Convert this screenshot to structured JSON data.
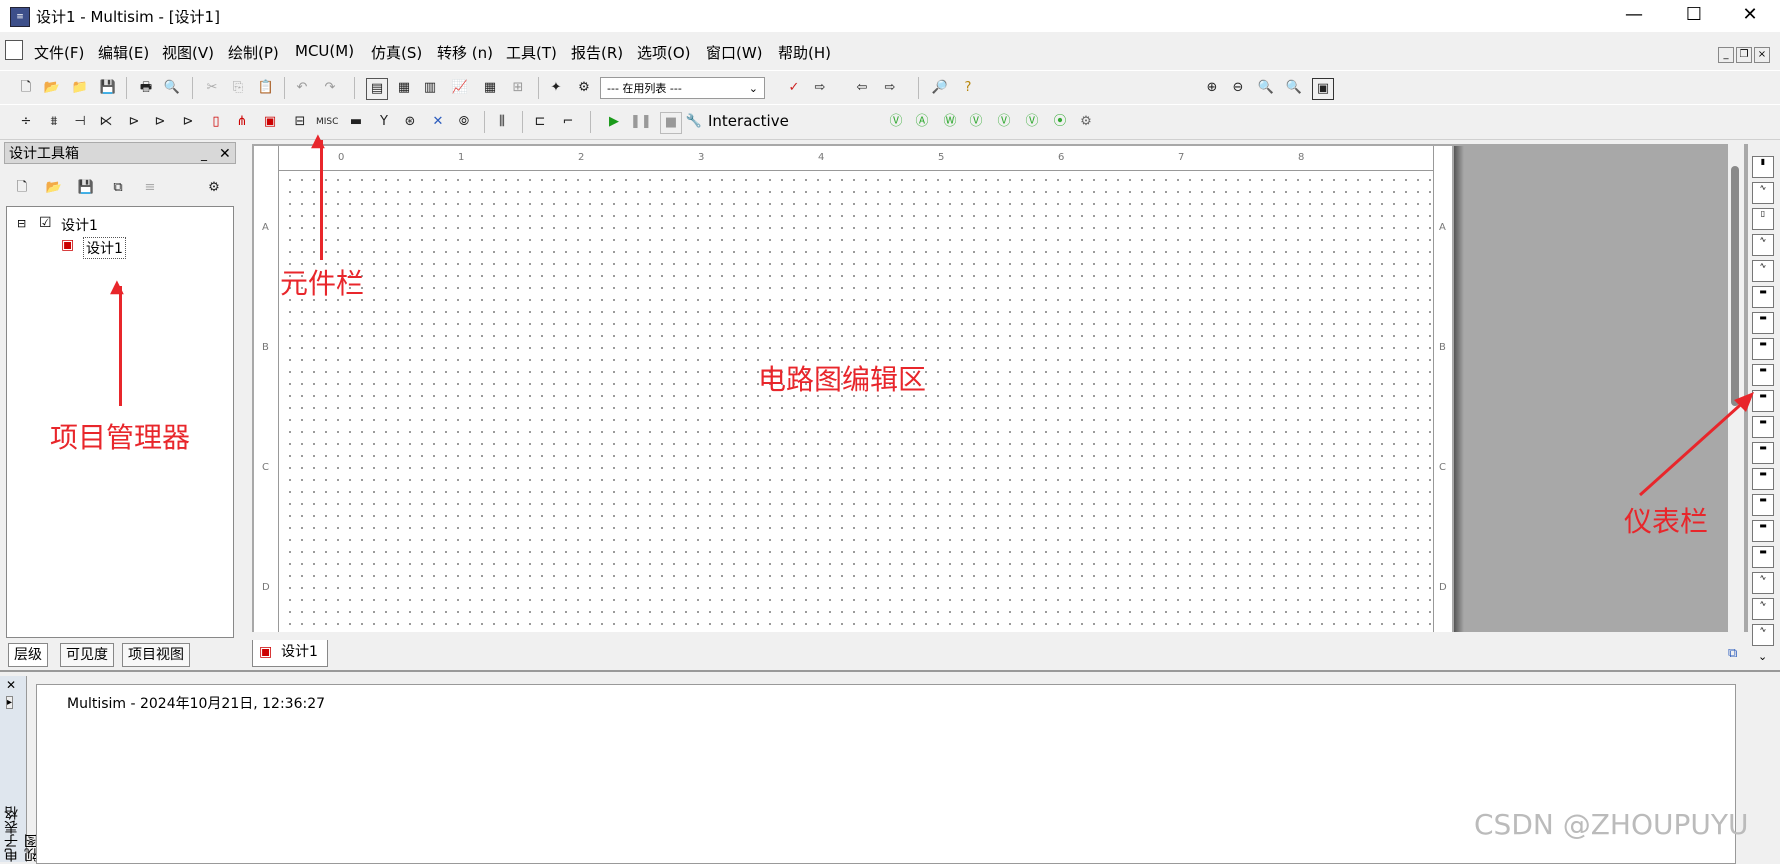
{
  "window": {
    "title": "设计1 - Multisim - [设计1]",
    "min_icon": "minimize-icon",
    "max_icon": "maximize-icon",
    "close_icon": "close-icon"
  },
  "menus": [
    "文件(F)",
    "编辑(E)",
    "视图(V)",
    "绘制(P)",
    "MCU(M)",
    "仿真(S)",
    "转移 (n)",
    "工具(T)",
    "报告(R)",
    "选项(O)",
    "窗口(W)",
    "帮助(H)"
  ],
  "toolbar": {
    "in_use_list": "--- 在用列表 ---",
    "interactive_label": "Interactive"
  },
  "components": {
    "misc_label": "MISC"
  },
  "design_toolbox": {
    "title": "设计工具箱",
    "tree_root": "设计1",
    "tree_child": "设计1",
    "tabs": [
      "层级",
      "可见度",
      "项目视图"
    ]
  },
  "canvas": {
    "ruler_top": [
      "0",
      "1",
      "2",
      "3",
      "4",
      "5",
      "6",
      "7",
      "8"
    ],
    "ruler_left": [
      "A",
      "B",
      "C",
      "D"
    ],
    "doc_tab": "设计1"
  },
  "log": {
    "side_label": "电子表格视图",
    "message": "Multisim  -  2024年10月21日, 12:36:27"
  },
  "annotations": {
    "component_bar": "元件栏",
    "project_manager": "项目管理器",
    "circuit_editor": "电路图编辑区",
    "instrument_bar": "仪表栏"
  },
  "watermark": "CSDN @ZHOUPUYU",
  "colors": {
    "annotation_red": "#e8262b",
    "sheet_bg": "#ffffff",
    "workspace_gray": "#a8a8a8"
  }
}
